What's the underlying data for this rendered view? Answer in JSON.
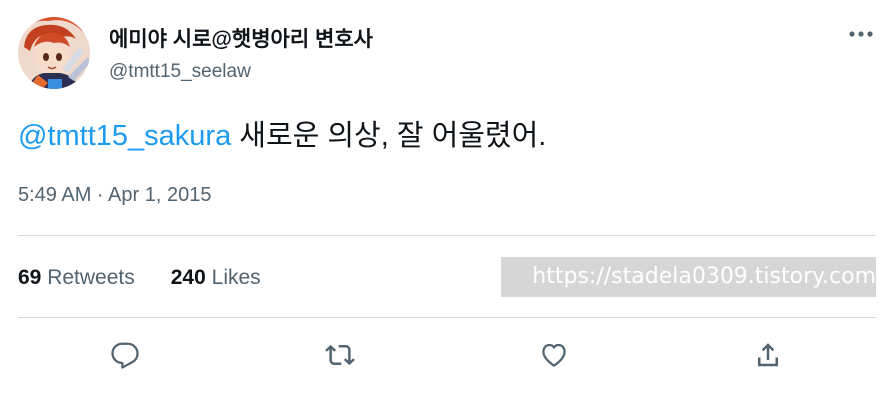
{
  "author": {
    "display_name": "에미야 시로@햇병아리 변호사",
    "handle": "@tmtt15_seelaw",
    "avatar_icon": "avatar-anime-character"
  },
  "more_icon": "more-dots-icon",
  "tweet": {
    "mention": "@tmtt15_sakura",
    "text": " 새로운 의상, 잘 어울렸어."
  },
  "timestamp": "5:49 AM · Apr 1, 2015",
  "stats": {
    "retweets": {
      "count": "69",
      "label": "Retweets"
    },
    "likes": {
      "count": "240",
      "label": "Likes"
    }
  },
  "watermark": "https://stadela0309.tistory.com",
  "actions": [
    "reply-icon",
    "retweet-icon",
    "like-icon",
    "share-icon"
  ],
  "colors": {
    "accent": "#1d9bf0",
    "text": "#0f1419",
    "secondary": "#536471",
    "divider": "#cfd9de"
  }
}
